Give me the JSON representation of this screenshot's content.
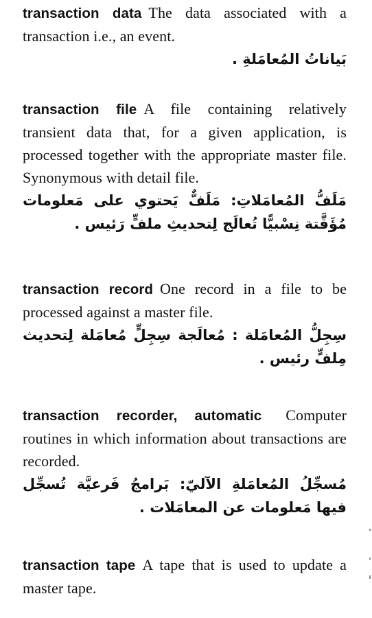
{
  "entries": [
    {
      "term": "transaction data",
      "definition": "The data associated with a transaction i.e., an event.",
      "arabic": "بَياناتُ المُعامَلةِ ."
    },
    {
      "term": "transaction file",
      "definition": "A file containing relatively transient data that, for a given application, is processed together with the appropriate master file. Synonymous with detail file.",
      "definition_display": "A file containing re­latively transient data that, for a given ap­plication, is processed together with the appropriate master file. Synonymous with detail file.",
      "arabic": "مَلَفُّ المُعامَلاتِ: مَلَفٌّ يَحتوي على مَعلومات مُؤَقَّتة نِسْبيًّا تُعالَج لِتحديثِ ملفٍّ رَئيس ."
    },
    {
      "term": "transaction record",
      "definition": "One record in a file to be processed against a master file.",
      "arabic": "سِجِلُّ المُعامَلة : مُعالَجة سِجِلٍّ مُعامَلة لِتحديث مِلفٍّ رئيس ."
    },
    {
      "term": "transaction recorder, automatic",
      "definition": "Computer routines in which information about transactions are recorded.",
      "arabic": "مُسجِّلُ المُعامَلةِ الآليّ: بَرامجُ فَرعيَّة تُسجِّل فيها مَعلومات عن المعامَلات ."
    },
    {
      "term": "transaction tape",
      "definition": "A tape that is used to update a master tape.",
      "arabic": ""
    }
  ]
}
